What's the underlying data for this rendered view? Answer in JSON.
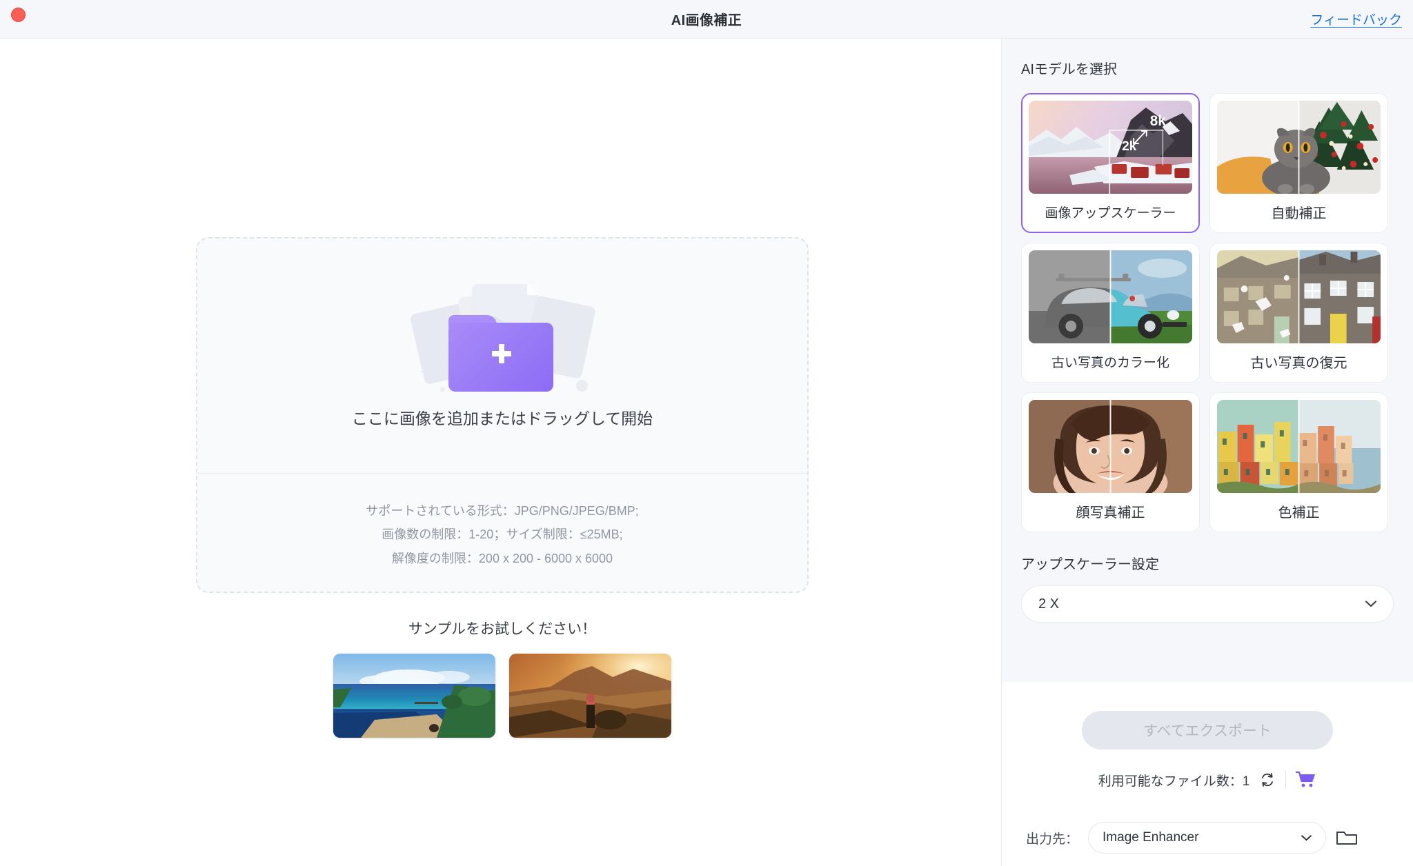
{
  "titlebar": {
    "title": "AI画像補正",
    "feedback_label": "フィードバック",
    "close_icon": "close-traffic-light",
    "feedback_color": "#1a6ee0"
  },
  "dropzone": {
    "prompt": "ここに画像を追加またはドラッグして開始",
    "notes": [
      "サポートされている形式：JPG/PNG/JPEG/BMP;",
      "画像数の制限：1-20；サイズ制限：≤25MB;",
      "解像度の制限：200 x 200 - 6000 x 6000"
    ],
    "art_icon": "folder-plus-illustration",
    "plus_icon": "plus-icon"
  },
  "samples": {
    "title": "サンプルをお試しください！",
    "items": [
      {
        "name": "tropical-lagoon-sample"
      },
      {
        "name": "sunset-hiker-sample"
      }
    ]
  },
  "sidebar": {
    "models_heading": "AIモデルを選択",
    "models": [
      {
        "label": "画像アップスケーラー",
        "selected": true,
        "thumb": "mountain-upscale-2k-8k",
        "badge_low": "2k",
        "badge_high": "8k"
      },
      {
        "label": "自動補正",
        "selected": false,
        "thumb": "cat-christmas-tree"
      },
      {
        "label": "古い写真のカラー化",
        "selected": false,
        "thumb": "vintage-beetle-car"
      },
      {
        "label": "古い写真の復元",
        "selected": false,
        "thumb": "old-townhouses"
      },
      {
        "label": "顔写真補正",
        "selected": false,
        "thumb": "woman-portrait"
      },
      {
        "label": "色補正",
        "selected": false,
        "thumb": "colorful-cliff-village"
      }
    ],
    "settings_heading": "アップスケーラー設定",
    "scale_select": {
      "value": "2 X",
      "caret_icon": "chevron-down-icon"
    },
    "accent_color": "#8b63f5"
  },
  "actions": {
    "export_label": "すべてエクスポート",
    "export_disabled": true,
    "quota_label": "利用可能なファイル数：",
    "quota_value": "1",
    "refresh_icon": "refresh-icon",
    "cart_icon": "shopping-cart-icon",
    "cart_color": "#7c5cf0"
  },
  "output": {
    "label": "出力先：",
    "value": "Image Enhancer",
    "caret_icon": "chevron-down-icon",
    "folder_icon": "folder-open-icon"
  }
}
